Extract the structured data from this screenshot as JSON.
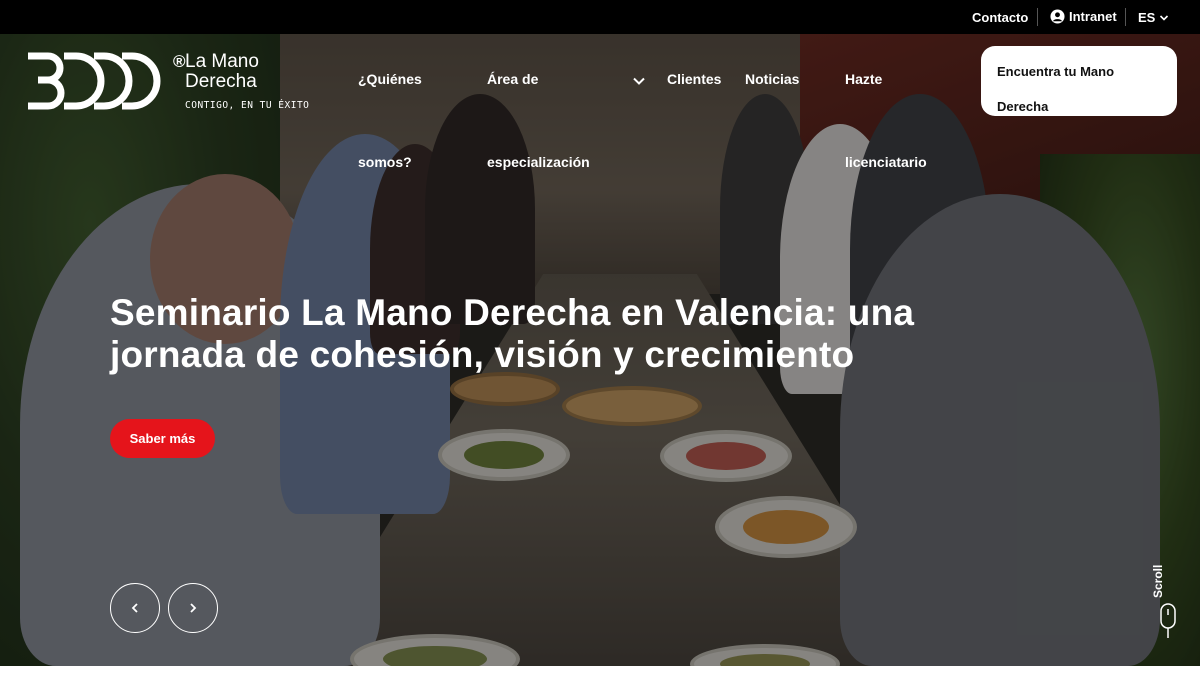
{
  "topbar": {
    "contact": "Contacto",
    "intranet": "Intranet",
    "language": "ES"
  },
  "logo": {
    "mark": "3DDD",
    "registered": "®",
    "name_line1": "La Mano",
    "name_line2": "Derecha",
    "tagline": "CONTIGO, EN TU ÉXITO"
  },
  "nav": {
    "quienes_l1": "¿Quiénes",
    "quienes_l2": "somos?",
    "area_l1": "Área de",
    "area_l2": "especialización",
    "clientes": "Clientes",
    "noticias": "Noticias",
    "hazte_l1": "Hazte",
    "hazte_l2": "licenciatario"
  },
  "cta": {
    "line1": "Encuentra tu Mano",
    "line2": "Derecha"
  },
  "hero": {
    "headline": "Seminario La Mano Derecha en Valencia: una jornada de cohesión, visión y crecimiento",
    "button": "Saber más",
    "scroll": "Scroll"
  },
  "colors": {
    "accent": "#e5141b",
    "topbar": "#000000"
  },
  "icons": {
    "user": "user-circle-icon",
    "chevron": "chevron-down-icon",
    "prev": "chevron-left-icon",
    "next": "chevron-right-icon",
    "scroll": "mouse-scroll-icon"
  }
}
